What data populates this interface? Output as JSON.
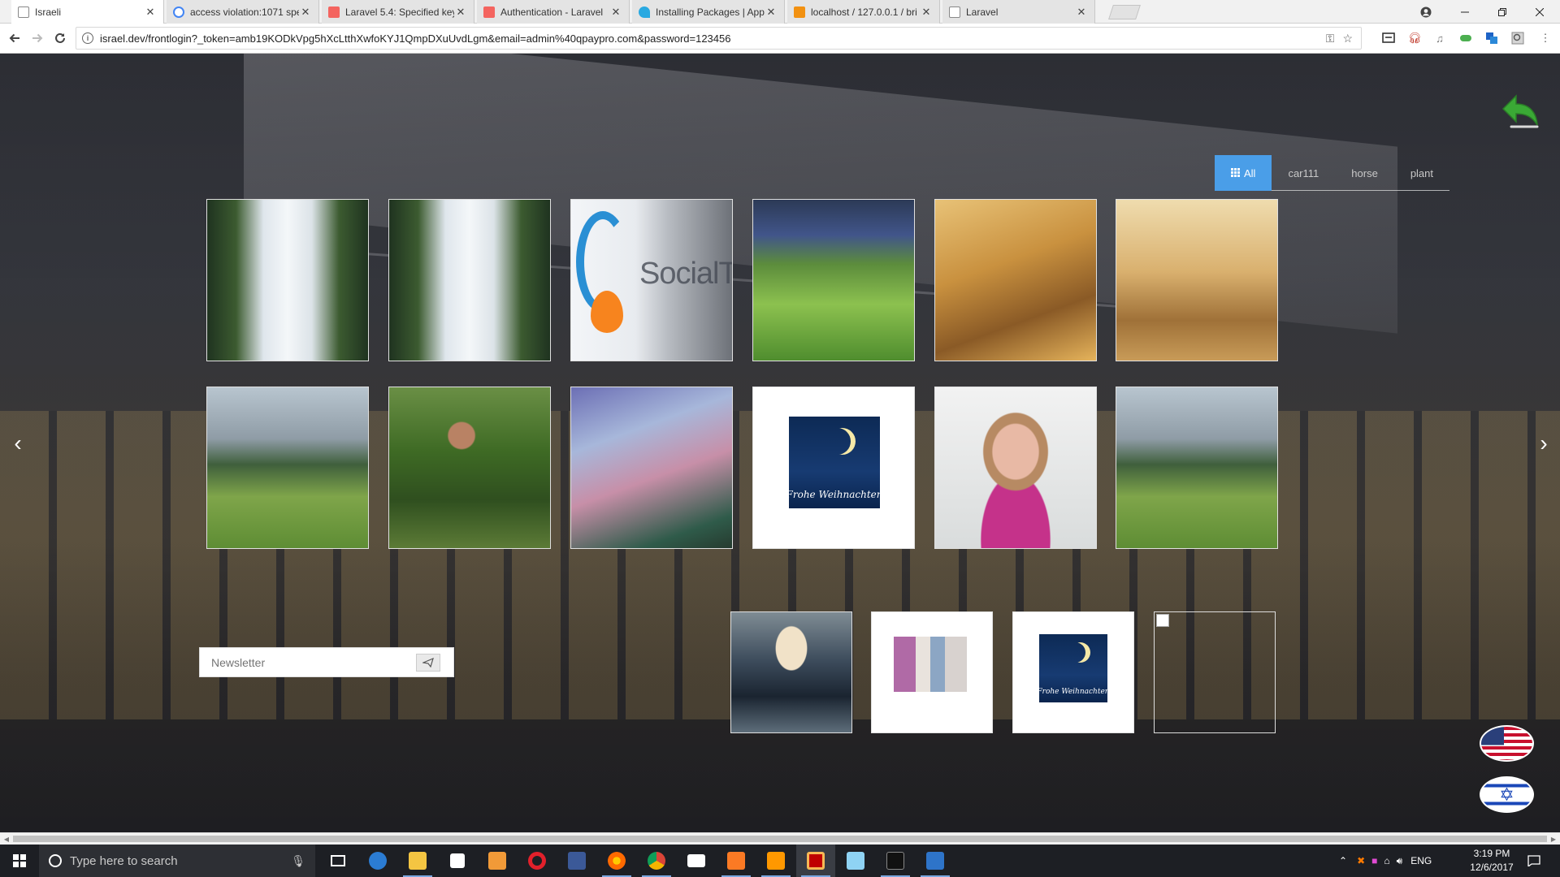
{
  "browser": {
    "tabs": [
      {
        "title": "Israeli",
        "active": true,
        "icon_color": "#ffffff"
      },
      {
        "title": "access violation:1071 spe",
        "active": false,
        "icon_color": "#4285f4"
      },
      {
        "title": "Laravel 5.4: Specified key",
        "active": false,
        "icon_color": "#f4645f"
      },
      {
        "title": "Authentication - Laravel",
        "active": false,
        "icon_color": "#f4645f"
      },
      {
        "title": "Installing Packages | App",
        "active": false,
        "icon_color": "#29a9e1"
      },
      {
        "title": "localhost / 127.0.0.1 / bri",
        "active": false,
        "icon_color": "#f29111"
      },
      {
        "title": "Laravel",
        "active": false,
        "icon_color": "#ffffff"
      }
    ],
    "close_glyph": "✕",
    "url": "israel.dev/frontlogin?_token=amb19KODkVpg5hXcLtthXwfoKYJ1QmpDXuUvdLgm&email=admin%40qpaypro.com&password=123456"
  },
  "page": {
    "filters": [
      {
        "label": "All",
        "active": true
      },
      {
        "label": "car111",
        "active": false
      },
      {
        "label": "horse",
        "active": false
      },
      {
        "label": "plant",
        "active": false
      }
    ],
    "gallery_rows": [
      [
        "snow-forest",
        "snow-forest",
        "socialtime-logo",
        "green-valley",
        "farmer-painting",
        "harvest-painting"
      ],
      [
        "red-barn-hills",
        "grape-picker",
        "fantasy-castle",
        "frohe-weihnachten",
        "girl-portrait",
        "red-barn-hills"
      ]
    ],
    "logo_text": "SocialTime",
    "xmas_text": "Frohe Weihnachten",
    "bottom_thumbs": [
      "lady-dusk",
      "office-people",
      "frohe-weihnachten",
      "broken-image"
    ],
    "newsletter": {
      "placeholder": "Newsletter",
      "send_icon": "send-icon"
    },
    "prev_arrow": "‹",
    "next_arrow": "›",
    "languages": [
      "us-flag",
      "israel-flag"
    ],
    "accent_color": "#4a9ee8"
  },
  "taskbar": {
    "search_placeholder": "Type here to search",
    "apps": [
      "task-view",
      "edge",
      "file-explorer",
      "store",
      "media-player",
      "opera",
      "facebook",
      "firefox",
      "chrome",
      "mail",
      "xampp",
      "sublime-text",
      "filezilla",
      "notepad",
      "cmd",
      "powershell"
    ],
    "language": "ENG",
    "time": "3:19 PM",
    "date": "12/6/2017"
  }
}
